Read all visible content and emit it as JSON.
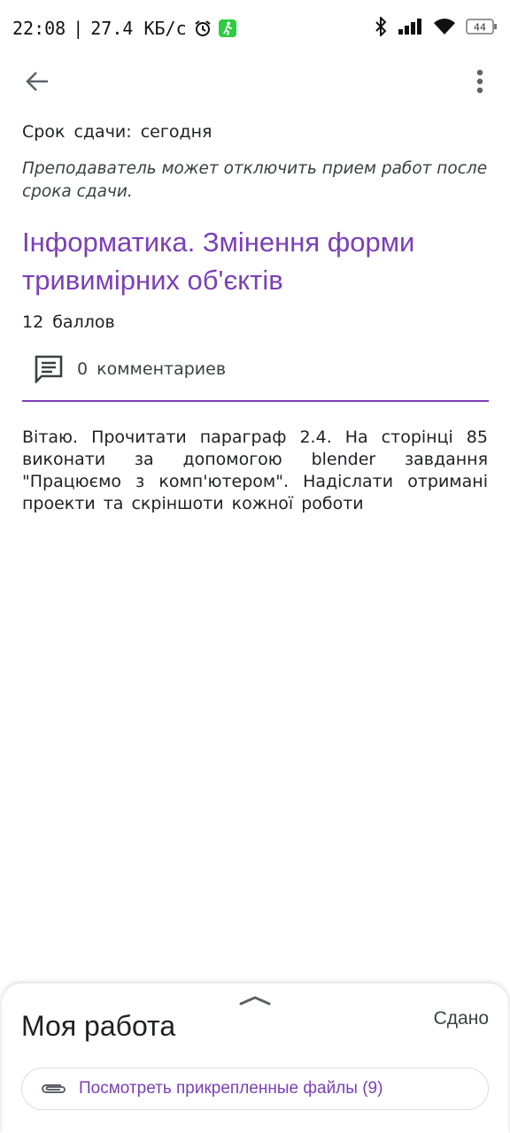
{
  "status_bar": {
    "time": "22:08",
    "separator": "|",
    "speed": "27.4 КБ/с",
    "battery": "44"
  },
  "assignment": {
    "due": "Срок сдачи: сегодня",
    "teacher_note": "Преподаватель может отключить прием работ после срока сдачи.",
    "title": "Інформатика. Змінення форми тривимірних об'єктів",
    "points": "12 баллов",
    "comments": "0 комментариев",
    "description": "Вітаю. Прочитати параграф 2.4. На сторінці 85 виконати за допомогою blender завдання \"Працюємо з комп'ютером\". Надіслати отримані проекти та скріншоти кожної роботи"
  },
  "my_work": {
    "title": "Моя работа",
    "status": "Сдано",
    "attachments_label": "Посмотреть прикрепленные файлы (9)"
  },
  "colors": {
    "accent": "#7b3fb6",
    "text": "#202124"
  }
}
